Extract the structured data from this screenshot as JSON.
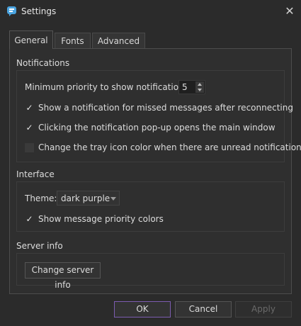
{
  "window": {
    "title": "Settings",
    "app_icon": "chat-bubble-icon",
    "close_glyph": "✕"
  },
  "tabs": [
    {
      "label": "General",
      "active": true
    },
    {
      "label": "Fonts",
      "active": false
    },
    {
      "label": "Advanced",
      "active": false
    }
  ],
  "notifications": {
    "section_title": "Notifications",
    "min_priority_label": "Minimum priority to show notifications:",
    "min_priority_value": "5",
    "options": [
      {
        "label": "Show a notification for missed messages after reconnecting",
        "checked": true
      },
      {
        "label": "Clicking the notification pop-up opens the main window",
        "checked": true
      },
      {
        "label": "Change the tray icon color when there are unread notifications",
        "checked": false
      }
    ]
  },
  "interface": {
    "section_title": "Interface",
    "theme_label": "Theme:",
    "theme_value": "dark purple",
    "priority_colors_label": "Show message priority colors",
    "priority_colors_checked": true
  },
  "server_info": {
    "section_title": "Server info",
    "change_button": "Change server info"
  },
  "footer": {
    "ok": "OK",
    "cancel": "Cancel",
    "apply": "Apply"
  },
  "colors": {
    "background": "#2b2b2b",
    "accent": "#7c5cb0",
    "app_icon": "#4aa3df"
  },
  "check_glyph": "✓"
}
